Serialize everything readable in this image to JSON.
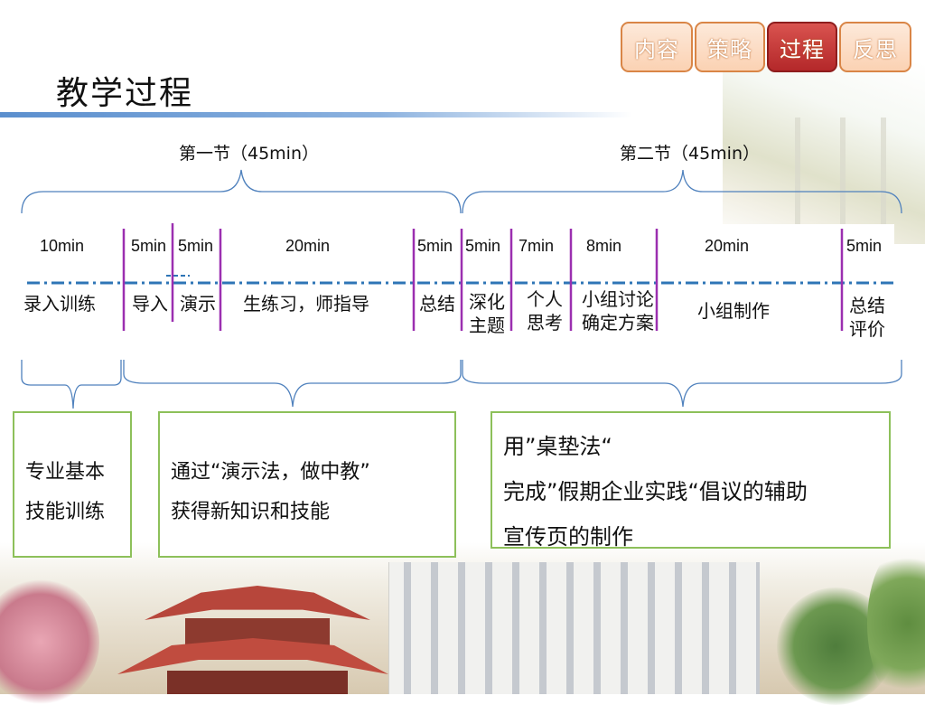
{
  "nav": {
    "tabs": [
      {
        "label": "内容",
        "active": false
      },
      {
        "label": "策略",
        "active": false
      },
      {
        "label": "过程",
        "active": true
      },
      {
        "label": "反思",
        "active": false
      }
    ]
  },
  "page_title": "教学过程",
  "sections": [
    {
      "label": "第一节（45min）"
    },
    {
      "label": "第二节（45min）"
    }
  ],
  "timeline": {
    "segments": [
      {
        "time": "10min",
        "activity": "录入训练"
      },
      {
        "time": "5min",
        "activity": "导入"
      },
      {
        "time": "5min",
        "activity": "演示"
      },
      {
        "time": "20min",
        "activity": "生练习，师指导"
      },
      {
        "time": "5min",
        "activity": "总结"
      },
      {
        "time": "5min",
        "activity_lines": [
          "深化",
          "主题"
        ]
      },
      {
        "time": "7min",
        "activity_lines": [
          "个人",
          "思考"
        ]
      },
      {
        "time": "8min",
        "activity_lines": [
          "小组讨论",
          "确定方案"
        ]
      },
      {
        "time": "20min",
        "activity": "小组制作"
      },
      {
        "time": "5min",
        "activity_lines": [
          "总结",
          "评价"
        ]
      }
    ]
  },
  "summary_boxes": [
    {
      "lines": [
        "专业基本",
        "技能训练"
      ]
    },
    {
      "lines": [
        "通过“演示法，做中教”",
        "获得新知识和技能"
      ]
    },
    {
      "lines": [
        "用”桌垫法“",
        "完成”假期企业实践“倡议的辅助",
        "宣传页的制作"
      ]
    }
  ],
  "colors": {
    "bracket": "#4f81bd",
    "divider": "#9b2fb0",
    "timeline_dash": "#2e75b6",
    "box_border": "#8dc05a",
    "tab_fill": "#fbd2b3",
    "tab_border": "#d98546",
    "tab_active_fill": "#c0302e"
  }
}
